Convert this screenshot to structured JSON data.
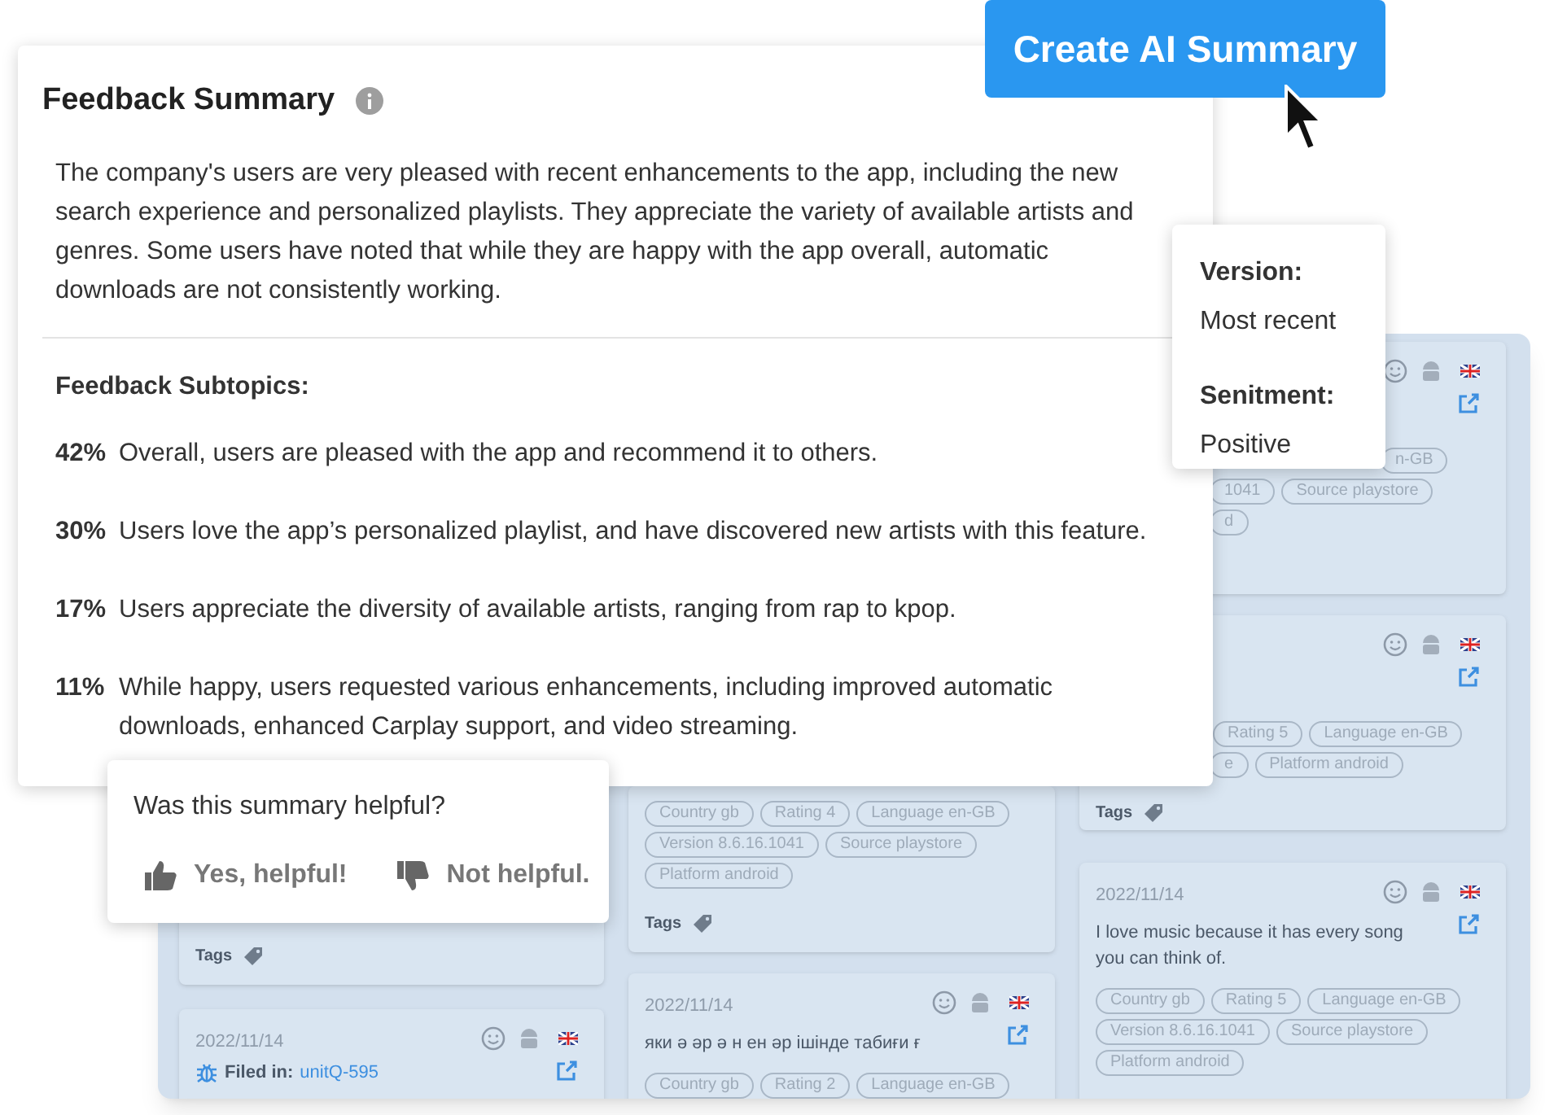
{
  "board": {
    "columns": [
      {
        "cards": [
          {
            "tags_label": "Tags"
          },
          {
            "date": "2022/11/14",
            "icons": true,
            "filed_in": {
              "label": "Filed in:",
              "link": "unitQ-595"
            }
          }
        ]
      },
      {
        "cards": [
          {
            "tag_rows": [
              [
                "Country gb",
                "Rating 4",
                "Language en-GB"
              ],
              [
                "Version 8.6.16.1041",
                "Source playstore"
              ],
              [
                "Platform android"
              ]
            ],
            "tags_label": "Tags"
          },
          {
            "date": "2022/11/14",
            "icons": true,
            "text": "яки ә әр ә н ен әр ішінде табиғи ғ",
            "tag_rows": [
              [
                "Country gb",
                "Rating 2",
                "Language en-GB"
              ]
            ]
          }
        ]
      },
      {
        "cards": [
          {
            "icons": true,
            "tag_rows": [
              [
                "n-GB"
              ],
              [
                "1041",
                "Source playstore"
              ],
              [
                "d"
              ]
            ]
          },
          {
            "icons": true,
            "tag_rows": [
              [
                "Rating 5",
                "Language en-GB"
              ],
              [
                "e",
                "Platform android"
              ]
            ],
            "tags_label": "Tags"
          },
          {
            "date": "2022/11/14",
            "icons": true,
            "text": "I love music because it has every song you can think of.",
            "tag_rows": [
              [
                "Country gb",
                "Rating 5",
                "Language en-GB"
              ],
              [
                "Version 8.6.16.1041",
                "Source playstore"
              ],
              [
                "Platform android"
              ]
            ]
          }
        ]
      }
    ]
  },
  "summary": {
    "title": "Feedback Summary",
    "text": "The company's users are very pleased with recent enhancements to the app, including the new search experience and personalized playlists. They appreciate the variety of available artists and genres. Some users have noted that while they are happy with the app overall, automatic downloads are not consistently working.",
    "subtopics_title": "Feedback Subtopics:",
    "subtopics": [
      {
        "percent": "42%",
        "text": "Overall, users are pleased with the app and recommend it to others."
      },
      {
        "percent": "30%",
        "text": "Users love the app’s personalized playlist, and have discovered new artists with this feature."
      },
      {
        "percent": "17%",
        "text": "Users appreciate the diversity of available artists, ranging from rap to kpop."
      },
      {
        "percent": "11%",
        "text": "While happy, users requested various enhancements, including improved automatic downloads, enhanced Carplay support, and video streaming."
      }
    ]
  },
  "ai_button": {
    "label": "Create AI Summary"
  },
  "tooltip": {
    "items": [
      {
        "label": "Version:",
        "value": "Most recent"
      },
      {
        "label": "Senitment:",
        "value": "Positive"
      }
    ]
  },
  "helpful": {
    "question": "Was this summary helpful?",
    "buttons": [
      {
        "kind": "yes",
        "label": "Yes, helpful!"
      },
      {
        "kind": "no",
        "label": "Not helpful."
      }
    ]
  }
}
